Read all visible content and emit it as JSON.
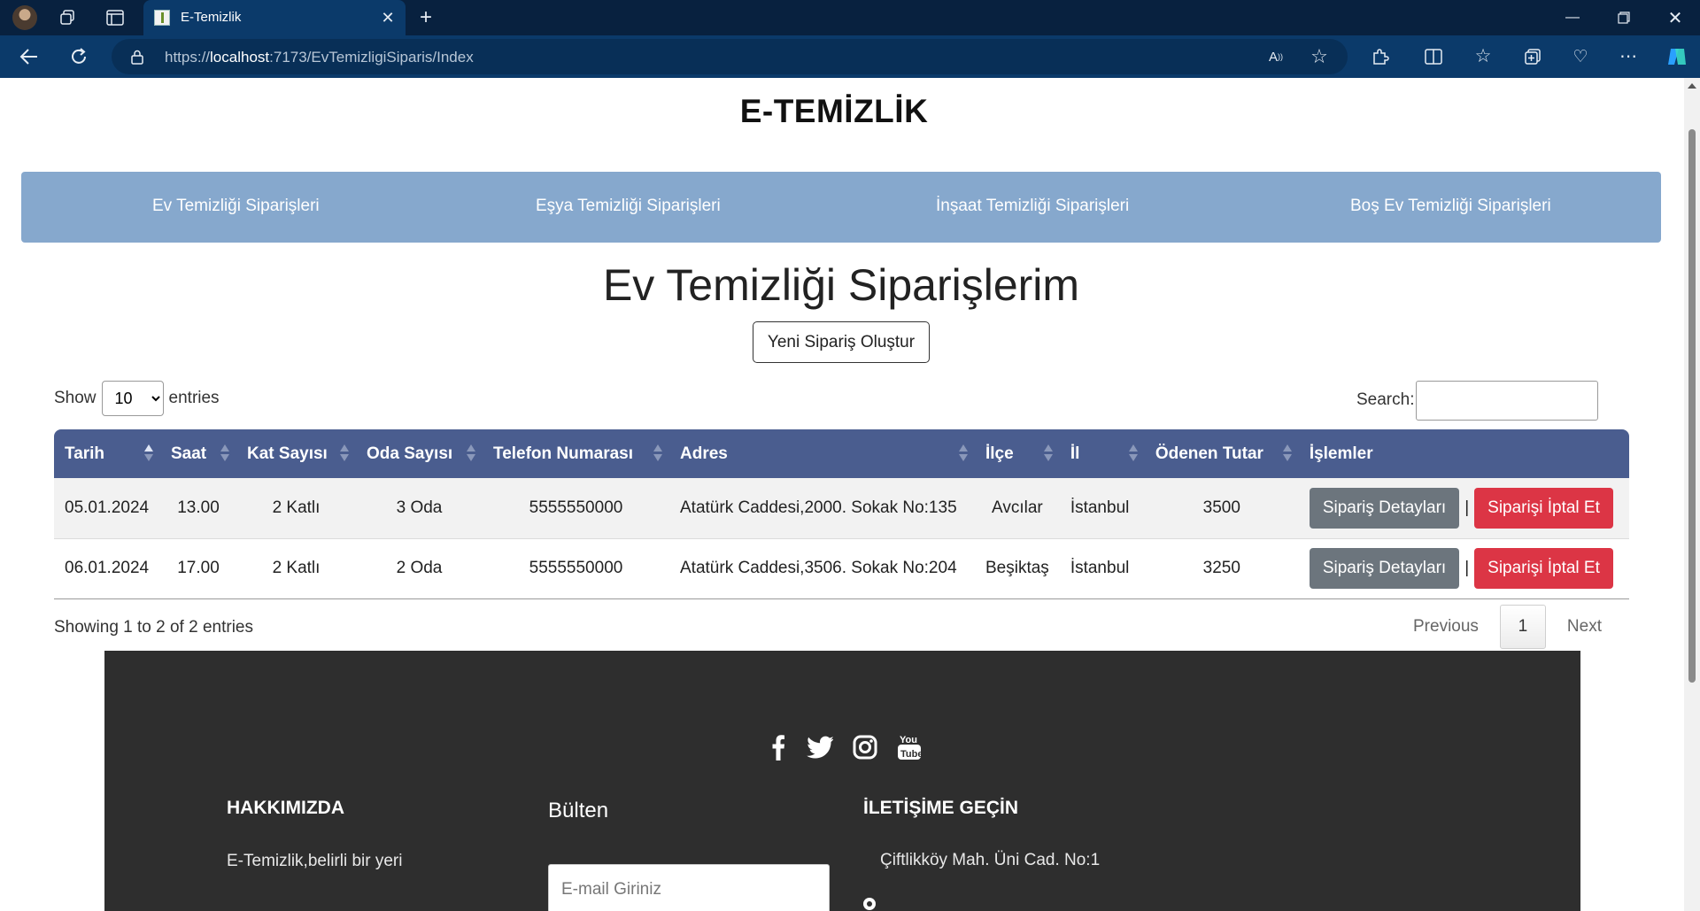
{
  "browser": {
    "tab_title": "E-Temizlik",
    "url_prefix": "https://",
    "url_host": "localhost",
    "url_rest": ":7173/EvTemizligiSiparis/Index"
  },
  "site": {
    "title": "E-TEMİZLİK"
  },
  "nav": {
    "items": [
      {
        "label": "Ev Temizliği Siparişleri"
      },
      {
        "label": "Eşya Temizliği Siparişleri"
      },
      {
        "label": "İnşaat Temizliği Siparişleri"
      },
      {
        "label": "Boş Ev Temizliği Siparişleri"
      }
    ]
  },
  "main": {
    "heading": "Ev Temizliği Siparişlerim",
    "new_order_label": "Yeni Sipariş Oluştur",
    "show_label": "Show",
    "entries_label": "entries",
    "page_length": "10",
    "search_label": "Search:"
  },
  "table": {
    "columns": [
      "Tarih",
      "Saat",
      "Kat Sayısı",
      "Oda Sayısı",
      "Telefon Numarası",
      "Adres",
      "İlçe",
      "İl",
      "Ödenen Tutar",
      "İşlemler"
    ],
    "rows": [
      {
        "tarih": "05.01.2024",
        "saat": "13.00",
        "kat": "2 Katlı",
        "oda": "3 Oda",
        "telefon": "5555550000",
        "adres": "Atatürk Caddesi,2000. Sokak No:135",
        "ilce": "Avcılar",
        "il": "İstanbul",
        "tutar": "3500"
      },
      {
        "tarih": "06.01.2024",
        "saat": "17.00",
        "kat": "2 Katlı",
        "oda": "2 Oda",
        "telefon": "5555550000",
        "adres": "Atatürk Caddesi,3506. Sokak No:204",
        "ilce": "Beşiktaş",
        "il": "İstanbul",
        "tutar": "3250"
      }
    ],
    "detail_label": "Sipariş Detayları",
    "separator": "|",
    "cancel_label": "Siparişi İptal Et",
    "info": "Showing 1 to 2 of 2 entries",
    "previous_label": "Previous",
    "current_page": "1",
    "next_label": "Next"
  },
  "footer": {
    "about_heading": "HAKKIMIZDA",
    "about_text": "E-Temizlik,belirli bir yeri",
    "newsletter_heading": "Bülten",
    "newsletter_placeholder": "E-mail Giriniz",
    "contact_heading": "İLETİŞİME GEÇİN",
    "address": "Çiftlikköy Mah. Üni Cad. No:1"
  },
  "colors": {
    "navbar": "#86a8cd",
    "table_header": "#4a5d8f",
    "detail_button": "#6c757d",
    "cancel_button": "#dc3545",
    "footer": "#2e2e2e"
  }
}
